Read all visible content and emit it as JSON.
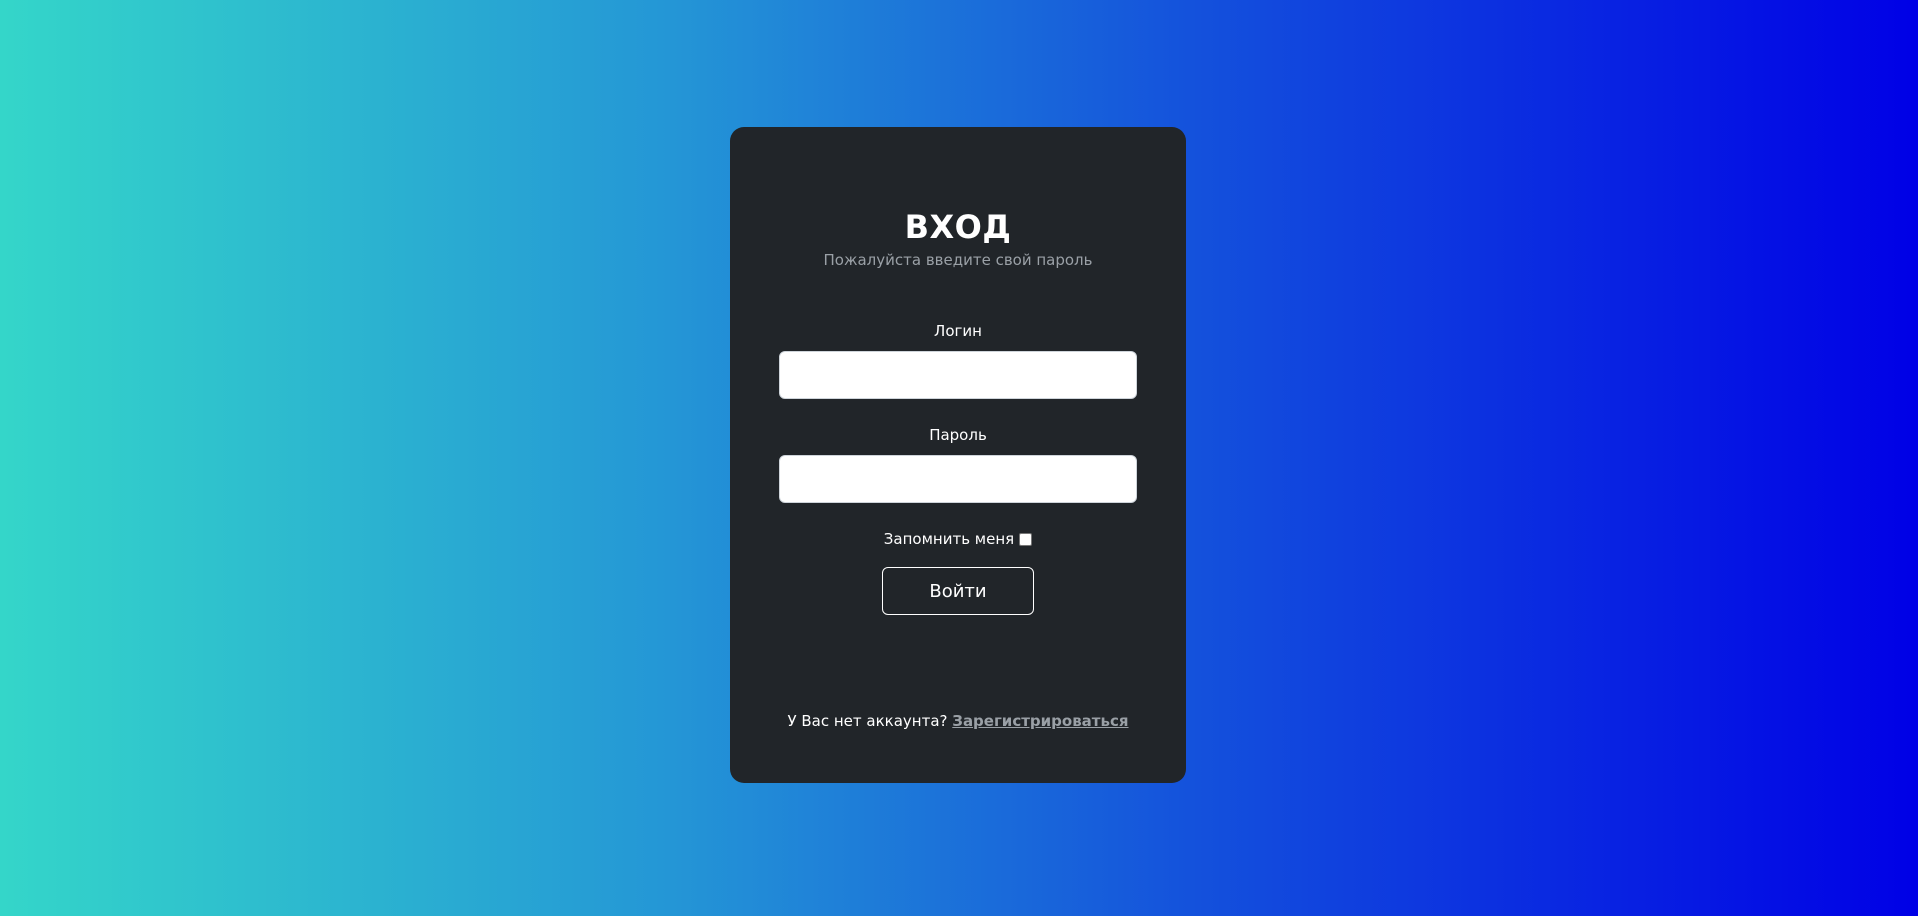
{
  "login_form": {
    "title": "ВХОД",
    "subtitle": "Пожалуйста введите свой пароль",
    "login_label": "Логин",
    "login_value": "",
    "password_label": "Пароль",
    "password_value": "",
    "remember_label": "Запомнить меня",
    "remember_checked": false,
    "submit_label": "Войти"
  },
  "footer": {
    "prompt": "У Вас нет аккаунта?",
    "register_link": "Зарегистрироваться"
  },
  "colors": {
    "card_background": "#212529",
    "gradient_start": "#34d6c9",
    "gradient_end": "#0000e6",
    "muted_text": "#9aa0a6"
  }
}
